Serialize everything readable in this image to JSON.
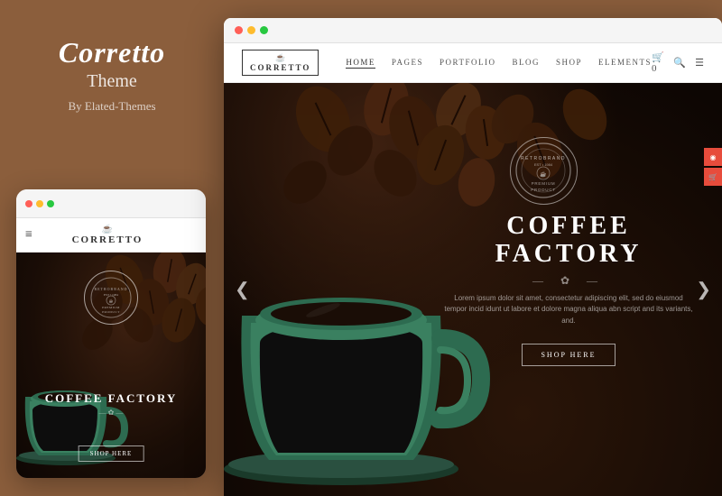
{
  "left_panel": {
    "theme_name": "Corretto",
    "theme_label": "Theme",
    "by_text": "By Elated-Themes"
  },
  "mobile_mockup": {
    "dots": [
      "dot1",
      "dot2",
      "dot3"
    ],
    "logo_icon": "☕",
    "logo_text": "CORRETTO",
    "hamburger": "≡",
    "hero_title": "COFFEE FACTORY",
    "divider": "✿",
    "shop_button": "SHOP HERE",
    "badge_lines": [
      "RETROBRAND",
      "EST",
      "PREMIUM",
      "PRODUCT"
    ]
  },
  "desktop_mockup": {
    "dots": [
      "dot1",
      "dot2",
      "dot3"
    ],
    "nav": {
      "logo_icon": "☕",
      "logo_text": "CORRETTO",
      "links": [
        "HOME",
        "PAGES",
        "PORTFOLIO",
        "BLOG",
        "SHOP",
        "ELEMENTS"
      ],
      "active_link": "HOME",
      "cart_icon": "🛒",
      "search_icon": "🔍",
      "menu_icon": "☰"
    },
    "hero": {
      "badge_text": "RETROBRAND\nEST 1984\nPREMIUM\nPRODUCT",
      "main_title": "COFFEE FACTORY",
      "divider": "✿",
      "description": "Lorem ipsum dolor sit amet, consectetur adipiscing elit, sed do eiusmod tempor incid idunt ut labore et dolore magna aliqua abn script and its variants, and.",
      "shop_button": "SHOP HERE",
      "prev_arrow": "❮",
      "next_arrow": "❯"
    }
  }
}
